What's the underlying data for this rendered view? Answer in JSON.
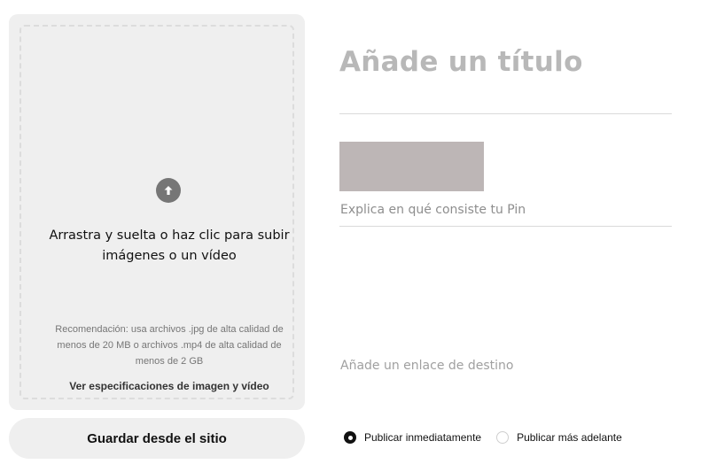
{
  "upload": {
    "icon": "upload-arrow-icon",
    "instruction": "Arrastra y suelta o haz clic para subir imágenes o un vídeo",
    "recommendation": "Recomendación: usa archivos .jpg de alta calidad de menos de 20 MB o archivos .mp4 de alta calidad de menos de 2 GB",
    "specs_link": "Ver especificaciones de imagen y vídeo"
  },
  "save_site_label": "Guardar desde el sitio",
  "form": {
    "title_placeholder": "Añade un título",
    "description_placeholder": "Explica en qué consiste tu Pin",
    "link_placeholder": "Añade un enlace de destino"
  },
  "publish": {
    "options": [
      {
        "label": "Publicar inmediatamente",
        "selected": true
      },
      {
        "label": "Publicar más adelante",
        "selected": false
      }
    ]
  },
  "colors": {
    "panel_bg": "#efefef",
    "placeholder_gray": "#b8b8b8",
    "avatar_block": "#bdb6b6"
  }
}
